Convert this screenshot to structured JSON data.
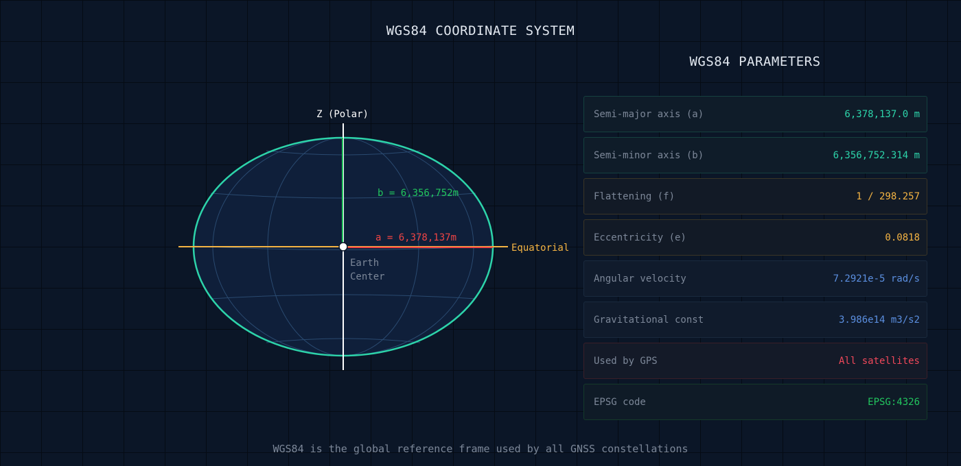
{
  "title": "WGS84 COORDINATE SYSTEM",
  "diagram": {
    "polar_axis_label": "Z (Polar)",
    "equatorial_axis_label": "Equatorial",
    "semi_minor_label": "b = 6,356,752m",
    "semi_major_label": "a = 6,378,137m",
    "center_label_line1": "Earth",
    "center_label_line2": "Center"
  },
  "panel": {
    "title": "WGS84 PARAMETERS",
    "params": [
      {
        "label": "Semi-major axis (a)",
        "value": "6,378,137.0 m",
        "color": "#2dd4aa"
      },
      {
        "label": "Semi-minor axis (b)",
        "value": "6,356,752.314 m",
        "color": "#2dd4aa"
      },
      {
        "label": "Flattening (f)",
        "value": "1 / 298.257",
        "color": "#f5b443"
      },
      {
        "label": "Eccentricity (e)",
        "value": "0.0818",
        "color": "#f5b443"
      },
      {
        "label": "Angular velocity",
        "value": "7.2921e-5 rad/s",
        "color": "#5b8fe0"
      },
      {
        "label": "Gravitational const",
        "value": "3.986e14 m3/s2",
        "color": "#5b8fe0"
      },
      {
        "label": "Used by GPS",
        "value": "All satellites",
        "color": "#f0485a"
      },
      {
        "label": "EPSG code",
        "value": "EPSG:4326",
        "color": "#22c55e"
      }
    ]
  },
  "footer": "WGS84 is the global reference frame used by all GNSS constellations",
  "colors": {
    "ellipse_outline": "#2dd4aa",
    "polar_axis": "#ffffff",
    "semi_minor_line": "#22c55e",
    "semi_major_line": "#ef4444",
    "equatorial_axis": "#f5b443"
  }
}
